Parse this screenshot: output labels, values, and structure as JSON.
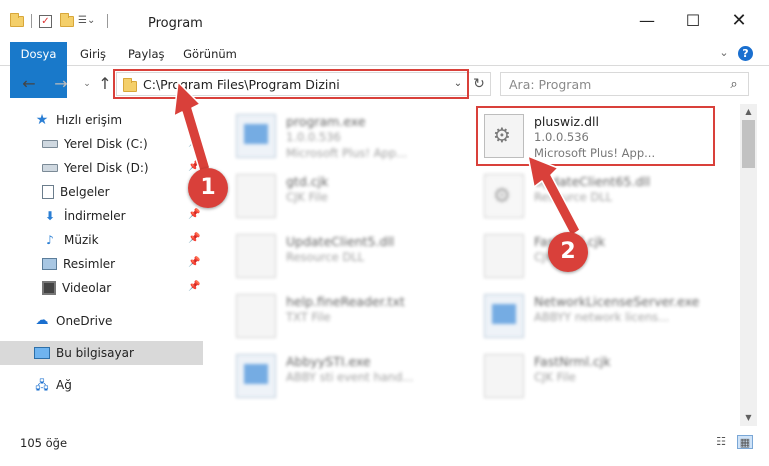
{
  "window": {
    "title": "Program",
    "minimize": "—",
    "maximize": "☐",
    "close": "✕"
  },
  "ribbon": {
    "tabs": [
      "Dosya",
      "Giriş",
      "Paylaş",
      "Görünüm"
    ],
    "expand": "⌄",
    "help": "?"
  },
  "nav": {
    "back": "←",
    "forward": "→",
    "recent": "⌄",
    "up": "↑",
    "address": "C:\\Program Files\\Program Dizini",
    "address_dropdown": "⌄",
    "refresh": "↻",
    "search_placeholder": "Ara: Program",
    "search_icon": "⌕"
  },
  "sidebar": {
    "items": [
      {
        "label": "Hızlı erişim",
        "icon": "star-icon"
      },
      {
        "label": "Yerel Disk (C:)",
        "icon": "drive-icon",
        "pinned": true
      },
      {
        "label": "Yerel Disk (D:)",
        "icon": "drive-icon",
        "pinned": true
      },
      {
        "label": "Belgeler",
        "icon": "documents-icon",
        "pinned": true
      },
      {
        "label": "İndirmeler",
        "icon": "download-icon",
        "pinned": true
      },
      {
        "label": "Müzik",
        "icon": "music-icon",
        "pinned": true
      },
      {
        "label": "Resimler",
        "icon": "pictures-icon",
        "pinned": true
      },
      {
        "label": "Videolar",
        "icon": "videos-icon",
        "pinned": true
      },
      {
        "label": "OneDrive",
        "icon": "cloud-icon"
      },
      {
        "label": "Bu bilgisayar",
        "icon": "computer-icon",
        "selected": true
      },
      {
        "label": "Ağ",
        "icon": "network-icon"
      }
    ],
    "pin_glyph": "📌"
  },
  "files": [
    {
      "name": "program.exe",
      "line2": "1.0.0.536",
      "line3": "Microsoft Plus! App...",
      "type": "exe",
      "blurred": true
    },
    {
      "name": "pluswiz.dll",
      "line2": "1.0.0.536",
      "line3": "Microsoft Plus! App...",
      "type": "dll",
      "blurred": false,
      "highlighted": true
    },
    {
      "name": "gtd.cjk",
      "line2": "CJK File",
      "line3": "",
      "type": "generic",
      "blurred": true
    },
    {
      "name": "UpdateClient65.dll",
      "line2": "Resource DLL",
      "line3": "",
      "type": "dll",
      "blurred": true
    },
    {
      "name": "UpdateClient5.dll",
      "line2": "Resource DLL",
      "line3": "",
      "type": "generic",
      "blurred": true
    },
    {
      "name": "FastKrnl.cjk",
      "line2": "CJK File",
      "line3": "",
      "type": "generic",
      "blurred": true
    },
    {
      "name": "help.fineReader.txt",
      "line2": "TXT File",
      "line3": "",
      "type": "generic",
      "blurred": true
    },
    {
      "name": "NetworkLicenseServer.exe",
      "line2": "ABBYY network licens...",
      "line3": "",
      "type": "exe",
      "blurred": true
    },
    {
      "name": "AbbyySTI.exe",
      "line2": "ABBY sti event hand...",
      "line3": "",
      "type": "exe",
      "blurred": true
    },
    {
      "name": "FastNrml.cjk",
      "line2": "CJK File",
      "line3": "",
      "type": "generic",
      "blurred": true
    }
  ],
  "status": {
    "item_count": "105 öğe",
    "details_view": "☷",
    "tiles_view": "▦"
  },
  "annotations": {
    "badge1": "1",
    "badge2": "2",
    "color": "#d9403a"
  },
  "scroll": {
    "up": "▲",
    "down": "▼"
  }
}
